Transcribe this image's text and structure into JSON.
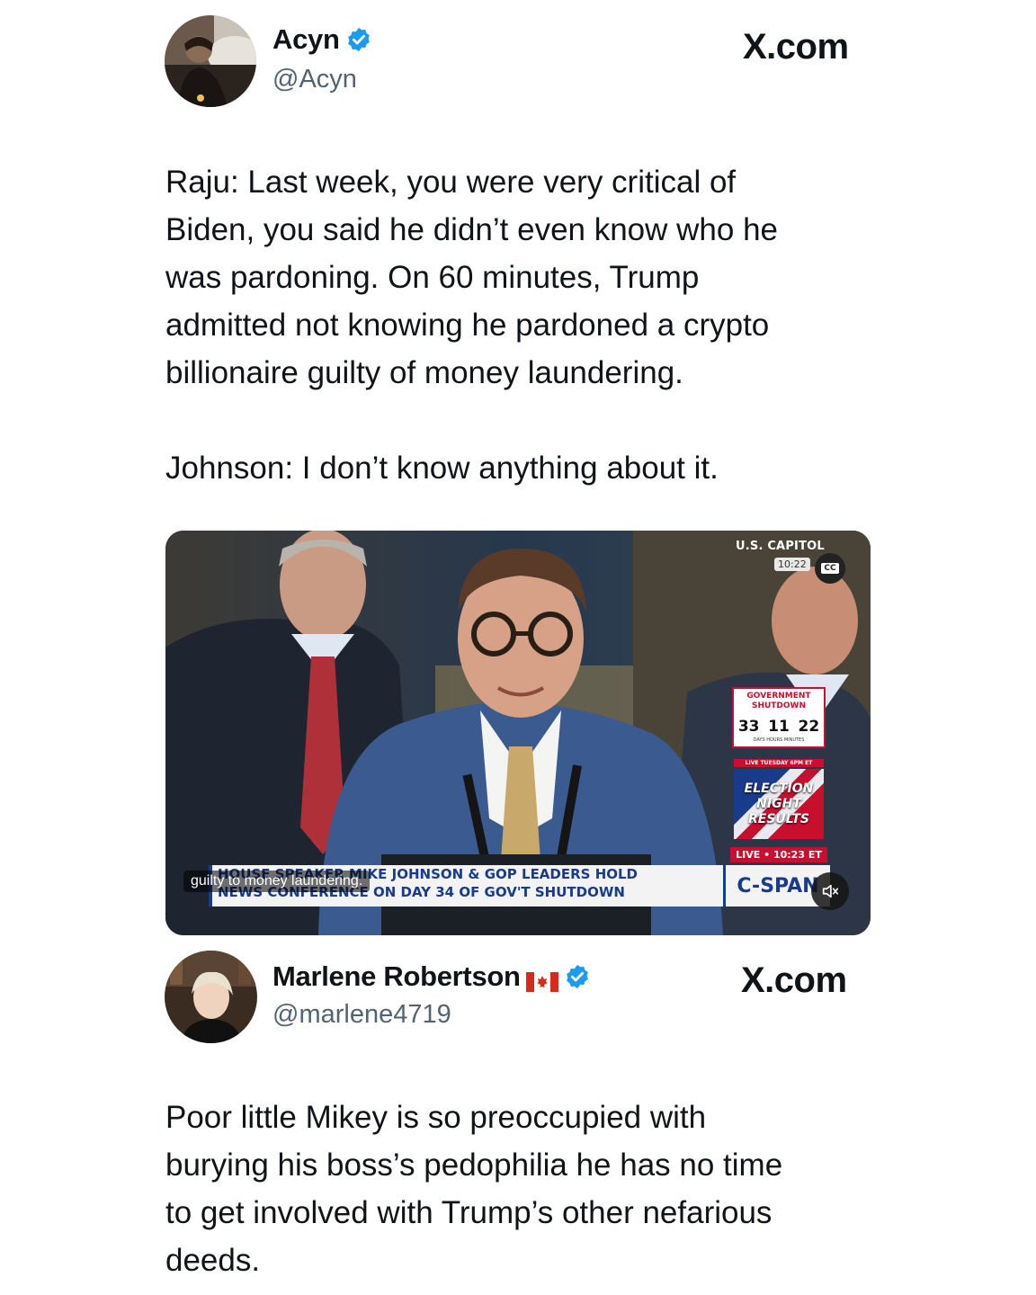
{
  "tweet1": {
    "name": "Acyn",
    "handle": "@Acyn",
    "site": "X.com",
    "text": "Raju: Last week, you were very critical of\nBiden, you said he didn’t even know who he\nwas pardoning. On 60 minutes, Trump\nadmitted not knowing he pardoned a crypto\nbillionaire guilty of money laundering.\n\nJohnson: I don’t know anything about it."
  },
  "video": {
    "location": "U.S. CAPITOL",
    "time": "10:22",
    "cc": "CC",
    "shutdown_title": "GOVERNMENT SHUTDOWN",
    "shutdown_days": "33",
    "shutdown_hours": "11",
    "shutdown_minutes": "22",
    "shutdown_units": "DAYS  HOURS  MINUTES",
    "election_pre": "LIVE TUESDAY 6PM ET",
    "election_title": "ELECTION NIGHT RESULTS",
    "live_label": "LIVE • 10:23 ET",
    "chyron_line1": "HOUSE SPEAKER MIKE JOHNSON & GOP LEADERS HOLD",
    "chyron_line2": "NEWS CONFERENCE ON DAY 34 OF GOV'T SHUTDOWN",
    "network": "C-SPAN",
    "caption": "guilty to money laundering."
  },
  "tweet2": {
    "name": "Marlene Robertson",
    "handle": "@marlene4719",
    "site": "X.com",
    "text": "Poor little Mikey is so preoccupied with\nburying his boss’s pedophilia he has no time\nto get involved with Trump’s other nefarious\ndeeds."
  },
  "colors": {
    "verified": "#1d9bf0",
    "muted": "#536471",
    "text": "#0f1419",
    "cspan_blue": "#1a3a8c",
    "shutdown_red": "#c8102e"
  }
}
